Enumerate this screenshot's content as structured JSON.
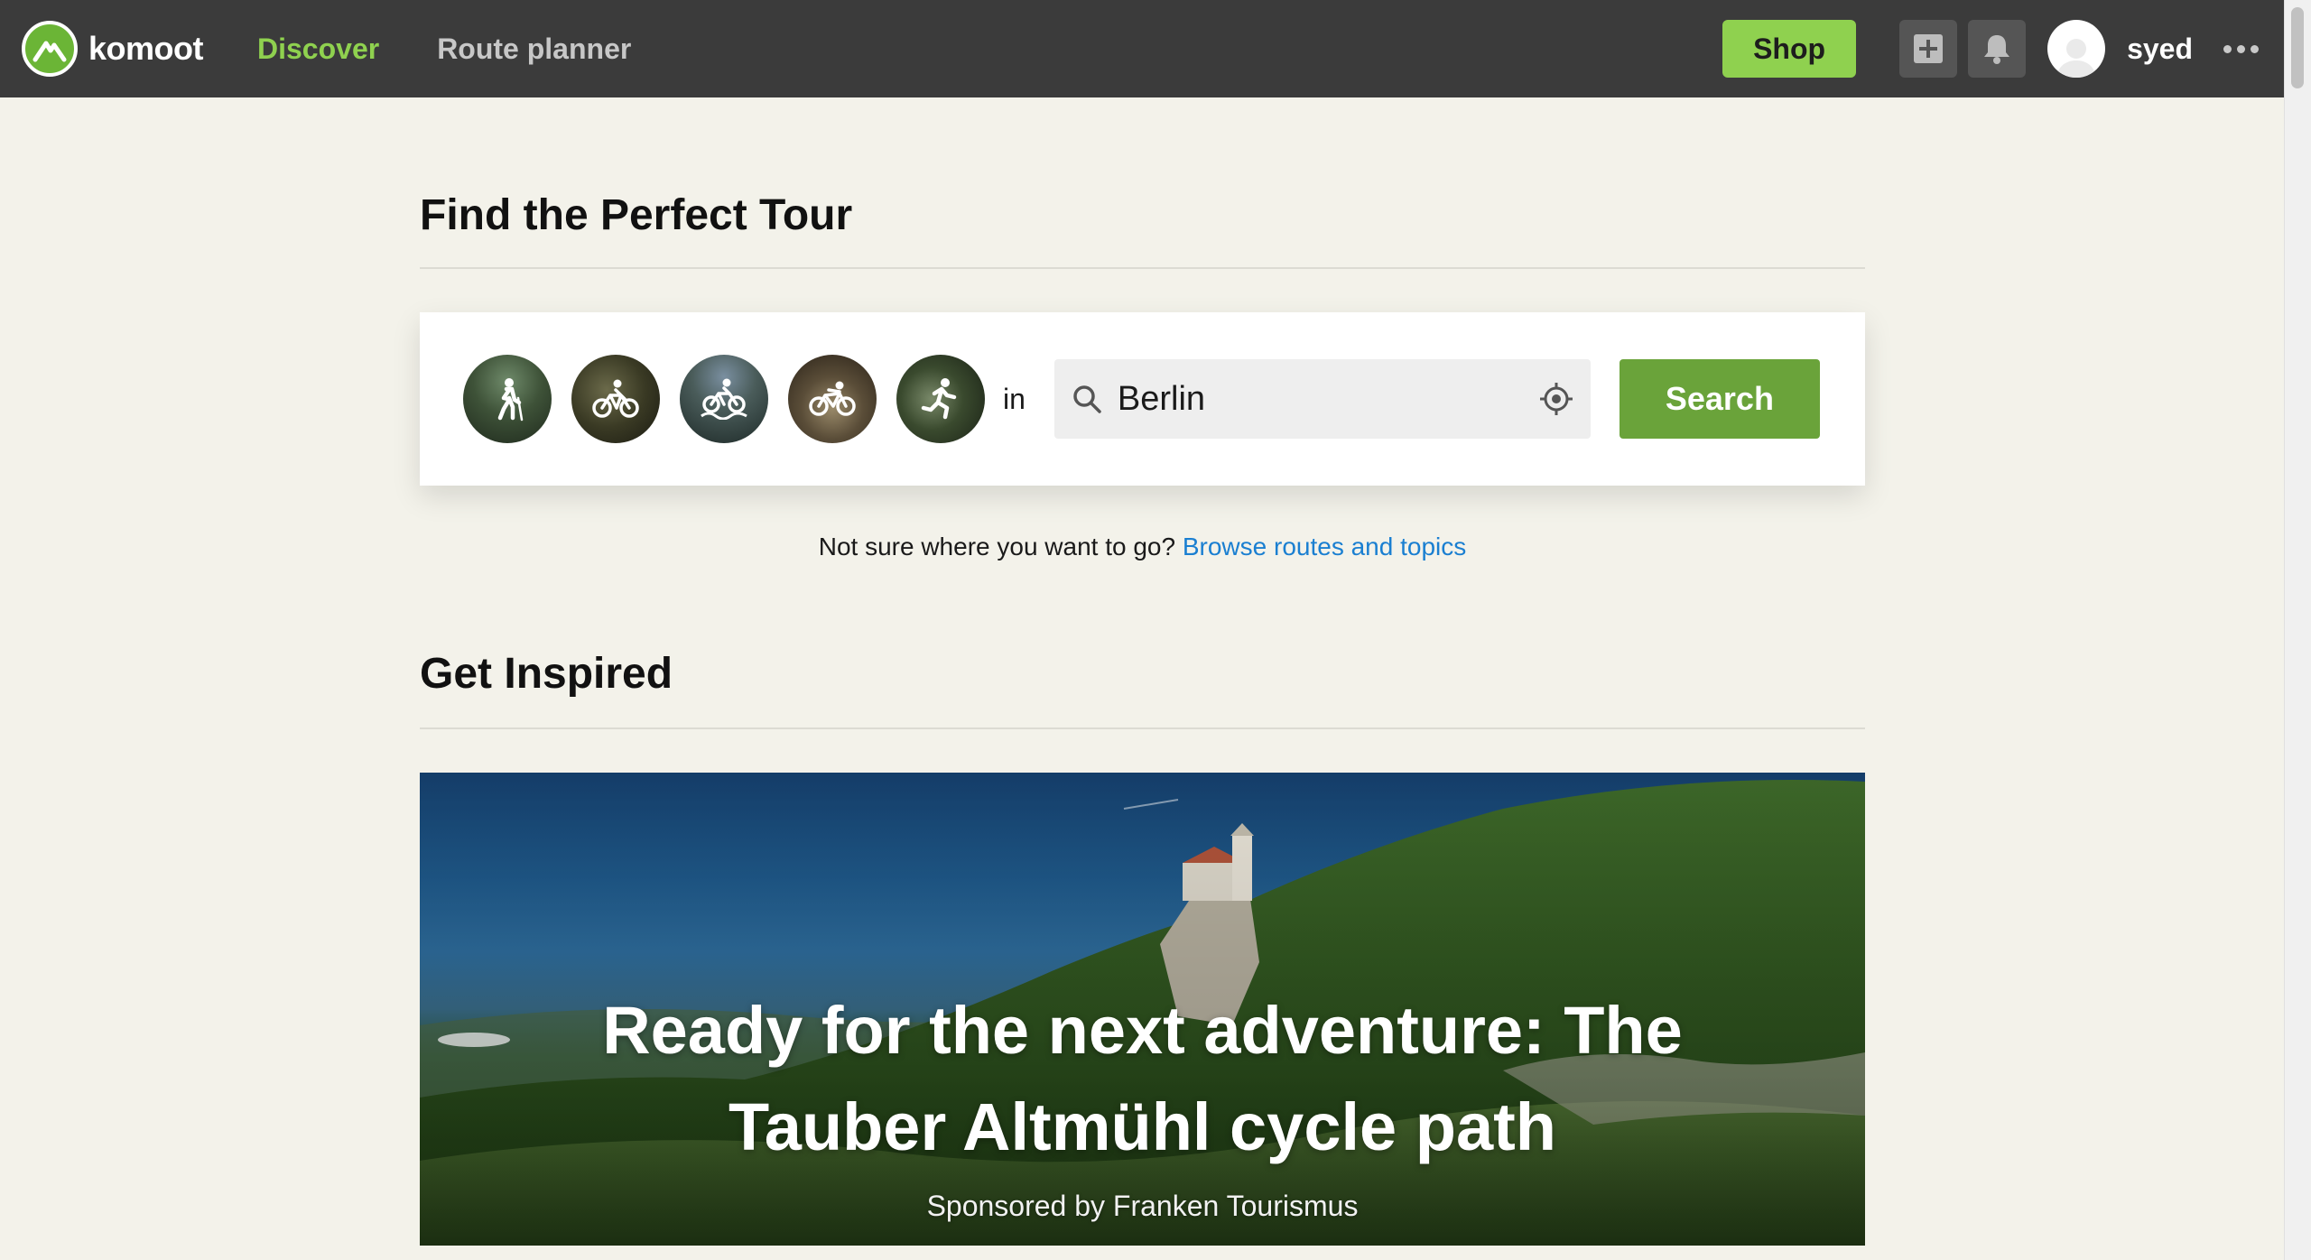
{
  "header": {
    "brand": "komoot",
    "nav": [
      {
        "label": "Discover",
        "active": true
      },
      {
        "label": "Route planner",
        "active": false
      }
    ],
    "shop_label": "Shop",
    "create_icon": "plus-square-icon",
    "notifications_icon": "bell-icon",
    "username": "syed",
    "more_icon": "more-dots-icon"
  },
  "find": {
    "title": "Find the Perfect Tour",
    "sports": [
      {
        "icon": "hiking-icon"
      },
      {
        "icon": "bike-touring-icon"
      },
      {
        "icon": "mountain-biking-icon"
      },
      {
        "icon": "road-cycling-icon"
      },
      {
        "icon": "running-icon"
      }
    ],
    "in_label": "in",
    "search_value": "Berlin",
    "search_button": "Search",
    "browse_prompt": "Not sure where you want to go?",
    "browse_link": "Browse routes and topics"
  },
  "inspired": {
    "title": "Get Inspired",
    "hero_title": "Ready for the next adventure: The Tauber Altmühl cycle path",
    "hero_sponsor": "Sponsored by Franken Tourismus"
  },
  "colors": {
    "nav_bg": "#3b3b3b",
    "accent_green": "#8fd14f",
    "search_button": "#6aa33a",
    "link_blue": "#1a7fd1",
    "page_bg": "#f3f2ea"
  }
}
